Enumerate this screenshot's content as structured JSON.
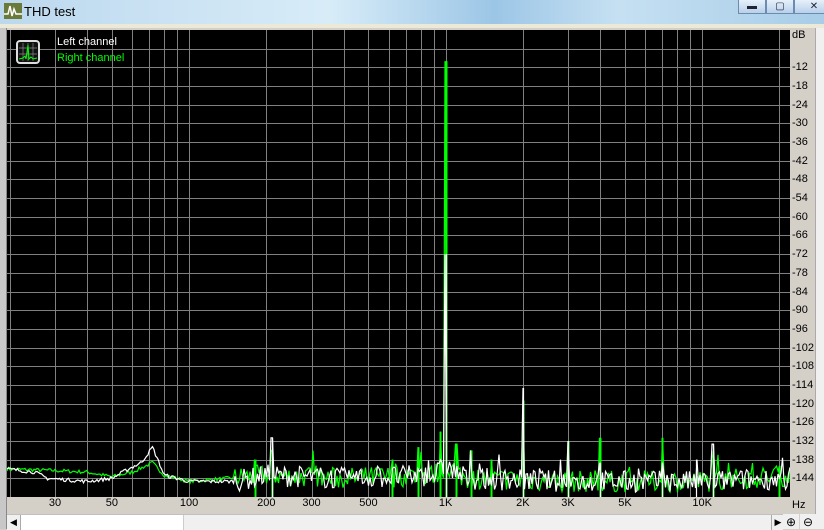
{
  "window": {
    "title": "THD test",
    "icon": "spectrum-app-icon",
    "minimize": "minimize-icon",
    "maximize": "maximize-icon",
    "close": "close-icon"
  },
  "legend": {
    "left": "Left channel",
    "right": "Right channel",
    "icon": "spectrum-icon"
  },
  "colors": {
    "left": "#ffffff",
    "right": "#00ff00",
    "background": "#000000",
    "grid": "#808080"
  },
  "chart_data": {
    "type": "line",
    "title": "THD test",
    "xlabel": "Hz",
    "ylabel": "dB",
    "xscale": "log",
    "xlim": [
      19.5,
      22000
    ],
    "ylim": [
      -150,
      0
    ],
    "grid": true,
    "legend_position": "top-left",
    "x_tick_labels": [
      {
        "value": 30,
        "label": "30"
      },
      {
        "value": 50,
        "label": "50"
      },
      {
        "value": 100,
        "label": "100"
      },
      {
        "value": 200,
        "label": "200"
      },
      {
        "value": 300,
        "label": "300"
      },
      {
        "value": 500,
        "label": "500"
      },
      {
        "value": 1000,
        "label": "1K"
      },
      {
        "value": 2000,
        "label": "2K"
      },
      {
        "value": 3000,
        "label": "3K"
      },
      {
        "value": 5000,
        "label": "5K"
      },
      {
        "value": 10000,
        "label": "10K"
      }
    ],
    "y_tick_labels": [
      "-12",
      "-18",
      "-24",
      "-30",
      "-36",
      "-42",
      "-48",
      "-54",
      "-60",
      "-66",
      "-72",
      "-78",
      "-84",
      "-90",
      "-96",
      "-102",
      "-108",
      "-114",
      "-120",
      "-126",
      "-132",
      "-138",
      "-144"
    ],
    "y_unit_label": "dB",
    "series": [
      {
        "name": "Left channel",
        "color": "#ffffff",
        "floor": [
          [
            19.5,
            -141
          ],
          [
            25,
            -142
          ],
          [
            28,
            -144
          ],
          [
            40,
            -145
          ],
          [
            50,
            -144
          ],
          [
            58,
            -141
          ],
          [
            65,
            -139
          ],
          [
            72,
            -134
          ],
          [
            80,
            -143
          ],
          [
            100,
            -145
          ],
          [
            150,
            -145
          ],
          [
            200,
            -143
          ],
          [
            400,
            -144
          ],
          [
            900,
            -143
          ],
          [
            1000,
            -140
          ],
          [
            1200,
            -144
          ],
          [
            3000,
            -145
          ],
          [
            10000,
            -145
          ],
          [
            22000,
            -144
          ]
        ],
        "peaks": [
          [
            210,
            -131
          ],
          [
            1000,
            -72
          ],
          [
            2000,
            -115
          ],
          [
            3000,
            -132
          ],
          [
            4000,
            -139
          ],
          [
            7000,
            -139
          ],
          [
            9500,
            -138
          ],
          [
            11000,
            -133
          ]
        ]
      },
      {
        "name": "Right channel",
        "color": "#00ff00",
        "floor": [
          [
            19.5,
            -141
          ],
          [
            30,
            -141.5
          ],
          [
            40,
            -142
          ],
          [
            50,
            -143.5
          ],
          [
            60,
            -142
          ],
          [
            72,
            -139
          ],
          [
            80,
            -143
          ],
          [
            100,
            -145
          ],
          [
            200,
            -143
          ],
          [
            400,
            -144
          ],
          [
            900,
            -143
          ],
          [
            1000,
            -140
          ],
          [
            1200,
            -144
          ],
          [
            3000,
            -145
          ],
          [
            10000,
            -145
          ],
          [
            22000,
            -143
          ]
        ],
        "peaks": [
          [
            180,
            -138
          ],
          [
            210,
            -135
          ],
          [
            620,
            -138
          ],
          [
            780,
            -134
          ],
          [
            950,
            -129
          ],
          [
            1000,
            -10
          ],
          [
            1100,
            -133
          ],
          [
            1250,
            -135
          ],
          [
            1500,
            -138
          ],
          [
            2000,
            -119
          ],
          [
            3000,
            -132
          ],
          [
            4000,
            -131
          ],
          [
            7000,
            -131
          ],
          [
            11000,
            -138
          ],
          [
            20000,
            -140
          ]
        ]
      }
    ]
  },
  "controls": {
    "scroll_left": "◀",
    "scroll_right": "▶",
    "zoom_in": "zoom-in-icon",
    "zoom_out": "zoom-out-icon"
  }
}
